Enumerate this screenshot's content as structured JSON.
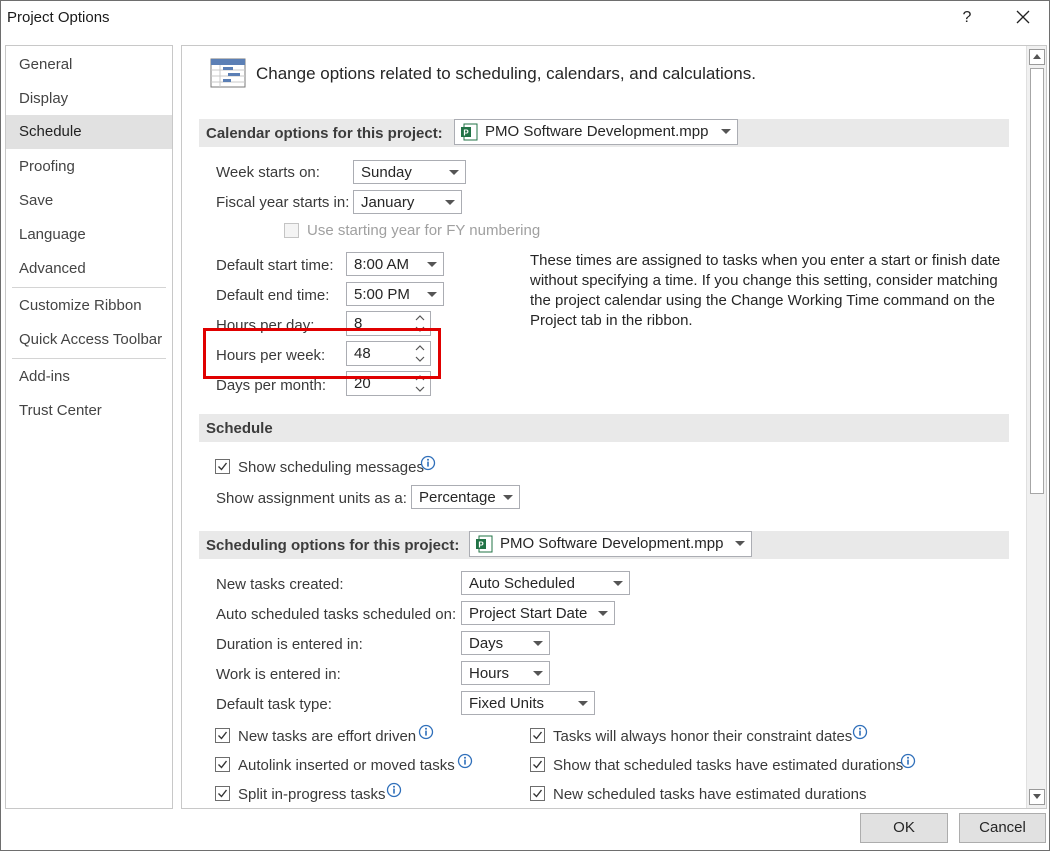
{
  "window": {
    "title": "Project Options",
    "help": "?"
  },
  "nav": {
    "items": [
      "General",
      "Display",
      "Schedule",
      "Proofing",
      "Save",
      "Language",
      "Advanced",
      "Customize Ribbon",
      "Quick Access Toolbar",
      "Add-ins",
      "Trust Center"
    ],
    "selected": "Schedule"
  },
  "header": {
    "text": "Change options related to scheduling, calendars, and calculations."
  },
  "calendar": {
    "section_label": "Calendar options for this project:",
    "project": "PMO Software Development.mpp",
    "week_starts_label": "Week starts on:",
    "week_starts_value": "Sunday",
    "fiscal_label": "Fiscal year starts in:",
    "fiscal_value": "January",
    "fy_numbering_label": "Use starting year for FY numbering",
    "default_start_label": "Default start time:",
    "default_start_value": "8:00 AM",
    "default_end_label": "Default end time:",
    "default_end_value": "5:00 PM",
    "hours_day_label": "Hours per day:",
    "hours_day_value": "8",
    "hours_week_label": "Hours per week:",
    "hours_week_value": "48",
    "days_month_label": "Days per month:",
    "days_month_value": "20",
    "note": "These times are assigned to tasks when you enter a start or finish date without specifying a time. If you change this setting, consider matching the project calendar using the Change Working Time command on the Project tab in the ribbon."
  },
  "schedule": {
    "section_label": "Schedule",
    "show_messages_label": "Show scheduling messages",
    "assignment_units_label": "Show assignment units as a:",
    "assignment_units_value": "Percentage"
  },
  "scheduling": {
    "section_label": "Scheduling options for this project:",
    "project": "PMO Software Development.mpp",
    "new_tasks_label": "New tasks created:",
    "new_tasks_value": "Auto Scheduled",
    "auto_sched_label": "Auto scheduled tasks scheduled on:",
    "auto_sched_value": "Project Start Date",
    "duration_label": "Duration is entered in:",
    "duration_value": "Days",
    "work_label": "Work is entered in:",
    "work_value": "Hours",
    "task_type_label": "Default task type:",
    "task_type_value": "Fixed Units",
    "effort_driven": "New tasks are effort driven",
    "autolink": "Autolink inserted or moved tasks",
    "split": "Split in-progress tasks",
    "honor_constraints": "Tasks will always honor their constraint dates",
    "show_estimated": "Show that scheduled tasks have estimated durations",
    "new_estimated": "New scheduled tasks have estimated durations"
  },
  "buttons": {
    "ok": "OK",
    "cancel": "Cancel"
  },
  "colors": {
    "highlight": "#e00000",
    "section_bg": "#e9e9e9",
    "selected_nav": "#e1e1e1",
    "project_icon": "#217346"
  },
  "icons": [
    "close-icon",
    "gantt-icon",
    "project-file-icon",
    "info-icon",
    "checkmark-icon",
    "dropdown-arrow-icon",
    "spin-up-icon",
    "spin-down-icon"
  ]
}
